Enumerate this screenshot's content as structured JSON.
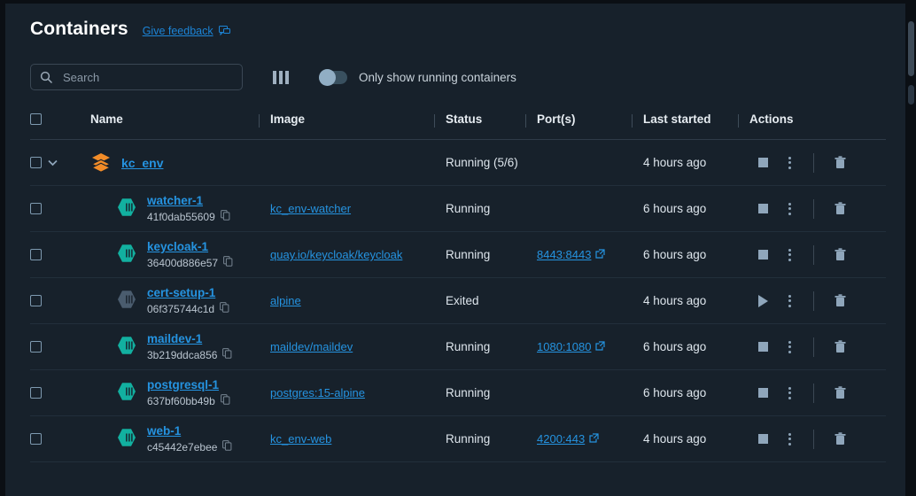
{
  "header": {
    "title": "Containers",
    "feedback_label": "Give feedback",
    "feedback_icon": "message-bubble-icon"
  },
  "toolbar": {
    "search_placeholder": "Search",
    "search_value": "",
    "search_icon": "search-icon",
    "columns_icon": "columns-icon",
    "toggle_label": "Only show running containers",
    "toggle_state": "off"
  },
  "table": {
    "columns": [
      {
        "key": "select",
        "label": ""
      },
      {
        "key": "name",
        "label": "Name"
      },
      {
        "key": "image",
        "label": "Image"
      },
      {
        "key": "status",
        "label": "Status"
      },
      {
        "key": "ports",
        "label": "Port(s)"
      },
      {
        "key": "started",
        "label": "Last started"
      },
      {
        "key": "actions",
        "label": "Actions"
      }
    ],
    "group": {
      "name": "kc_env",
      "icon": "stack-layers-icon",
      "status": "Running (5/6)",
      "image": "",
      "ports": "",
      "started": "4 hours ago",
      "expanded": true,
      "primary_action": "stop-icon"
    },
    "rows": [
      {
        "name": "watcher-1",
        "container_id": "41f0dab55609",
        "icon": "container-icon",
        "icon_state": "running",
        "image": "kc_env-watcher",
        "status": "Running",
        "ports": "",
        "started": "6 hours ago",
        "primary_action": "stop-icon"
      },
      {
        "name": "keycloak-1",
        "container_id": "36400d886e57",
        "icon": "container-icon",
        "icon_state": "running",
        "image": "quay.io/keycloak/keycloak",
        "status": "Running",
        "ports": "8443:8443",
        "started": "6 hours ago",
        "primary_action": "stop-icon"
      },
      {
        "name": "cert-setup-1",
        "container_id": "06f375744c1d",
        "icon": "container-icon",
        "icon_state": "exited",
        "image": "alpine",
        "status": "Exited",
        "ports": "",
        "started": "4 hours ago",
        "primary_action": "play-icon"
      },
      {
        "name": "maildev-1",
        "container_id": "3b219ddca856",
        "icon": "container-icon",
        "icon_state": "running",
        "image": "maildev/maildev",
        "status": "Running",
        "ports": "1080:1080",
        "started": "6 hours ago",
        "primary_action": "stop-icon"
      },
      {
        "name": "postgresql-1",
        "container_id": "637bf60bb49b",
        "icon": "container-icon",
        "icon_state": "running",
        "image": "postgres:15-alpine",
        "status": "Running",
        "ports": "",
        "started": "6 hours ago",
        "primary_action": "stop-icon"
      },
      {
        "name": "web-1",
        "container_id": "c45442e7ebee",
        "icon": "container-icon",
        "icon_state": "running",
        "image": "kc_env-web",
        "status": "Running",
        "ports": "4200:443",
        "started": "4 hours ago",
        "primary_action": "stop-icon"
      }
    ]
  },
  "colors": {
    "background": "#17212b",
    "link": "#2593e0",
    "group_icon": "#f28c28",
    "container_running": "#12b0a0",
    "container_exited": "#4a5c6e",
    "text": "#dde5ec"
  }
}
